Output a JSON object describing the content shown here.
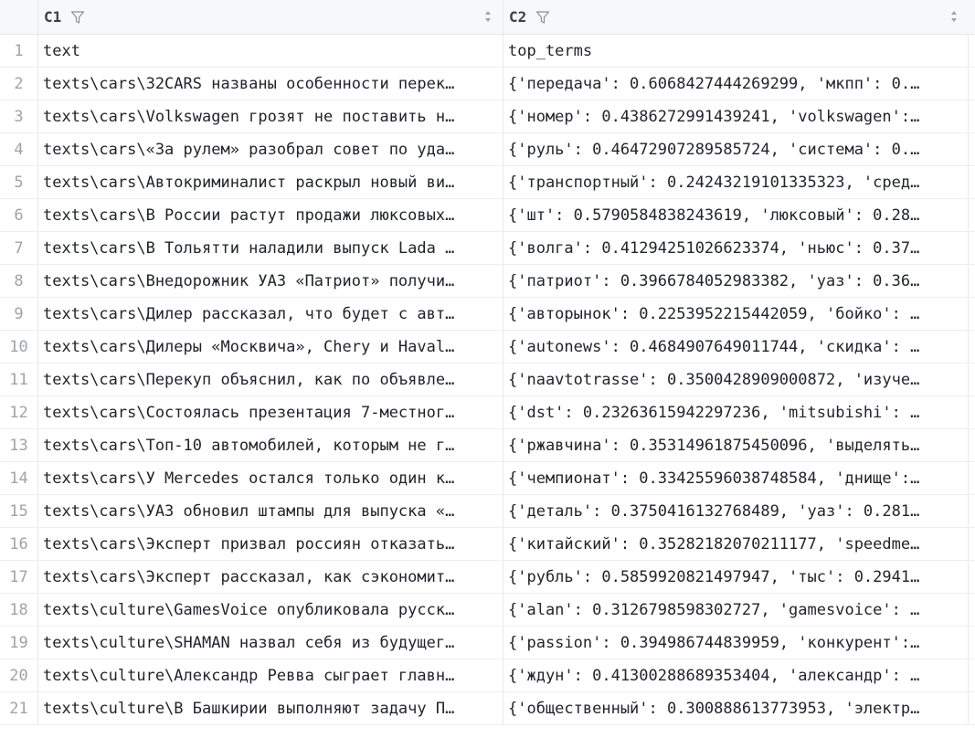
{
  "columns": [
    {
      "label": "C1"
    },
    {
      "label": "C2"
    }
  ],
  "rows": [
    {
      "num": "1",
      "c1": "text",
      "c2": "top_terms"
    },
    {
      "num": "2",
      "c1": "texts\\cars\\32CARS названы особенности перек…",
      "c2": "{'передача': 0.6068427444269299, 'мкпп': 0.…"
    },
    {
      "num": "3",
      "c1": "texts\\cars\\Volkswagen грозят не поставить н…",
      "c2": "{'номер': 0.4386272991439241, 'volkswagen':…"
    },
    {
      "num": "4",
      "c1": "texts\\cars\\«За рулем» разобрал совет по уда…",
      "c2": "{'руль': 0.46472907289585724, 'система': 0.…"
    },
    {
      "num": "5",
      "c1": "texts\\cars\\Автокриминалист раскрыл новый ви…",
      "c2": "{'транспортный': 0.24243219101335323, 'сред…"
    },
    {
      "num": "6",
      "c1": "texts\\cars\\В России растут продажи люксовых…",
      "c2": "{'шт': 0.5790584838243619, 'люксовый': 0.28…"
    },
    {
      "num": "7",
      "c1": "texts\\cars\\В Тольятти наладили выпуск Lada …",
      "c2": "{'волга': 0.41294251026623374, 'ньюс': 0.37…"
    },
    {
      "num": "8",
      "c1": "texts\\cars\\Внедорожник УАЗ «Патриот» получи…",
      "c2": "{'патриот': 0.3966784052983382, 'уаз': 0.36…"
    },
    {
      "num": "9",
      "c1": "texts\\cars\\Дилер рассказал, что будет с авт…",
      "c2": "{'авторынок': 0.2253952215442059, 'бойко': …"
    },
    {
      "num": "10",
      "c1": "texts\\cars\\Дилеры «Москвича», Chery и Haval…",
      "c2": "{'autonews': 0.4684907649011744, 'скидка': …"
    },
    {
      "num": "11",
      "c1": "texts\\cars\\Перекуп объяснил, как по объявле…",
      "c2": "{'naavtotrasse': 0.3500428909000872, 'изуче…"
    },
    {
      "num": "12",
      "c1": "texts\\cars\\Состоялась презентация 7-местног…",
      "c2": "{'dst': 0.23263615942297236, 'mitsubishi': …"
    },
    {
      "num": "13",
      "c1": "texts\\cars\\Топ-10 автомобилей, которым не г…",
      "c2": "{'ржавчина': 0.35314961875450096, 'выделять…"
    },
    {
      "num": "14",
      "c1": "texts\\cars\\У Mercedes остался только один к…",
      "c2": "{'чемпионат': 0.33425596038748584, 'днище':…"
    },
    {
      "num": "15",
      "c1": "texts\\cars\\УАЗ обновил штампы для выпуска «…",
      "c2": "{'деталь': 0.3750416132768489, 'уаз': 0.281…"
    },
    {
      "num": "16",
      "c1": "texts\\cars\\Эксперт призвал россиян отказать…",
      "c2": "{'китайский': 0.35282182070211177, 'speedme…"
    },
    {
      "num": "17",
      "c1": "texts\\cars\\Эксперт рассказал, как сэкономит…",
      "c2": "{'рубль': 0.5859920821497947, 'тыс': 0.2941…"
    },
    {
      "num": "18",
      "c1": "texts\\culture\\GamesVoice опубликовала русск…",
      "c2": "{'alan': 0.3126798598302727, 'gamesvoice': …"
    },
    {
      "num": "19",
      "c1": "texts\\culture\\SHAMAN назвал себя из будущег…",
      "c2": "{'passion': 0.394986744839959, 'конкурент':…"
    },
    {
      "num": "20",
      "c1": "texts\\culture\\Александр Ревва сыграет главн…",
      "c2": "{'ждун': 0.41300288689353404, 'александр': …"
    },
    {
      "num": "21",
      "c1": "texts\\culture\\В Башкирии выполняют задачу П…",
      "c2": "{'общественный': 0.300888613773953, 'электр…"
    }
  ]
}
